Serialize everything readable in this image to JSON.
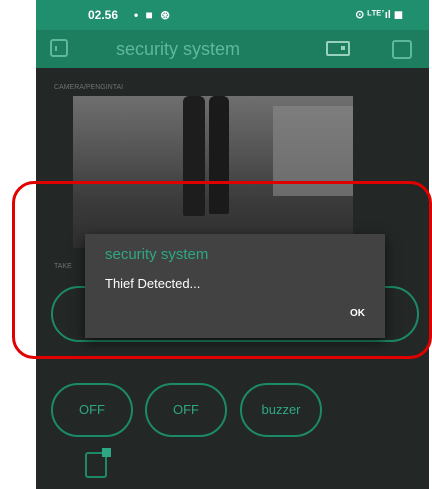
{
  "status_bar": {
    "time": "02.56",
    "left_icons": "• ■ ⊛",
    "right_icons": "⊙ ᴸᵀᴱ᾿ıl ◼"
  },
  "app": {
    "title": "security system"
  },
  "camera": {
    "label": "CAMERA/PENGINTAI"
  },
  "take_label": "TAKE",
  "dialog": {
    "title": "security system",
    "message": "Thief Detected...",
    "ok_label": "OK"
  },
  "buttons": {
    "btn1": "OFF",
    "btn2": "OFF",
    "btn3": "buzzer"
  },
  "colors": {
    "accent": "#1c7d5f",
    "highlight": "#e00000",
    "background": "#232726"
  }
}
